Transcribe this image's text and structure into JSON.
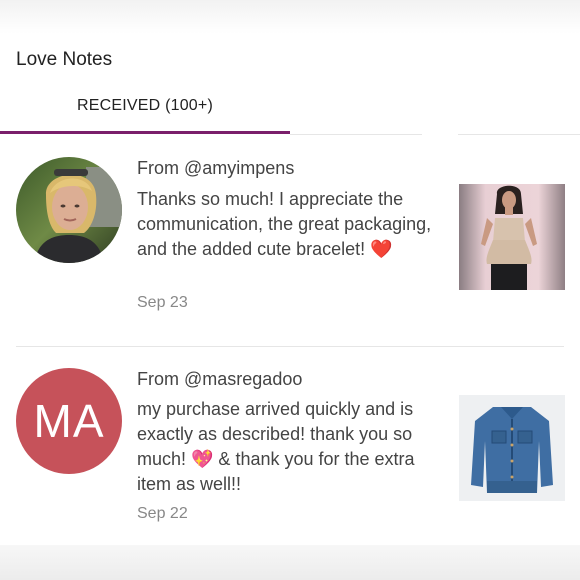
{
  "header": {
    "title": "Love Notes"
  },
  "tabs": {
    "received_label": "RECEIVED (100+)"
  },
  "notes": [
    {
      "from_prefix": "From",
      "handle": "@amyimpens",
      "message": "Thanks so much! I appreciate the communication, the great packaging, and the added cute bracelet! ❤️",
      "date": "Sep 23"
    },
    {
      "from_prefix": "From",
      "handle": "@masregadoo",
      "avatar_initials": "MA",
      "message": "my purchase arrived quickly and is exactly as described! thank you so much! 💖 & thank you for the extra item as well!!",
      "date": "Sep 22"
    }
  ],
  "colors": {
    "accent": "#7a1f6b",
    "initials_avatar_bg": "#c6525a"
  }
}
